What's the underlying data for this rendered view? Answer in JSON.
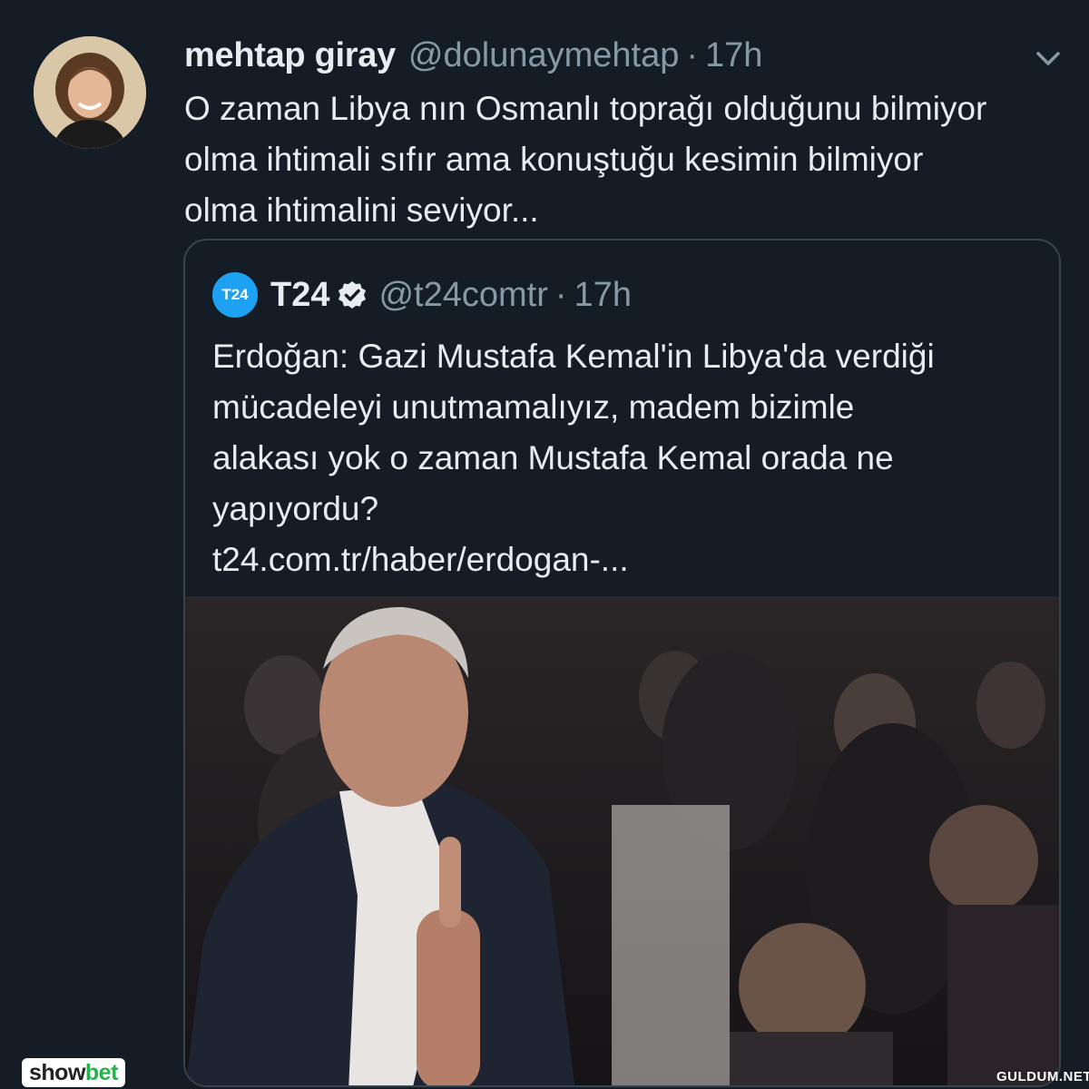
{
  "tweet": {
    "display_name": "mehtap giray",
    "handle": "@dolunaymehtap",
    "separator": "·",
    "time": "17h",
    "text": "O zaman Libya nın Osmanlı toprağı olduğunu bilmiyor\nolma ihtimali sıfır ama konuştuğu kesimin bilmiyor\nolma ihtimalini seviyor...",
    "avatar_icon": "user-avatar",
    "menu_icon": "chevron-down-icon"
  },
  "quote": {
    "logo_text": "T24",
    "display_name": "T24",
    "verified_icon": "verified-badge-icon",
    "handle": "@t24comtr",
    "separator": "·",
    "time": "17h",
    "text": "Erdoğan: Gazi Mustafa Kemal'in Libya'da verdiği\nmücadeleyi unutmamalıyız, madem bizimle\nalakası yok o zaman Mustafa Kemal orada ne\nyapıyordu?\nt24.com.tr/haber/erdogan-..."
  },
  "watermarks": {
    "showbet_main": "show",
    "showbet_accent": "bet",
    "site": "GULDUM.NET"
  },
  "colors": {
    "background": "#141d26",
    "text_primary": "#e6ecf0",
    "text_secondary": "#8899a6",
    "border": "#38444d",
    "accent": "#1da1f2"
  }
}
